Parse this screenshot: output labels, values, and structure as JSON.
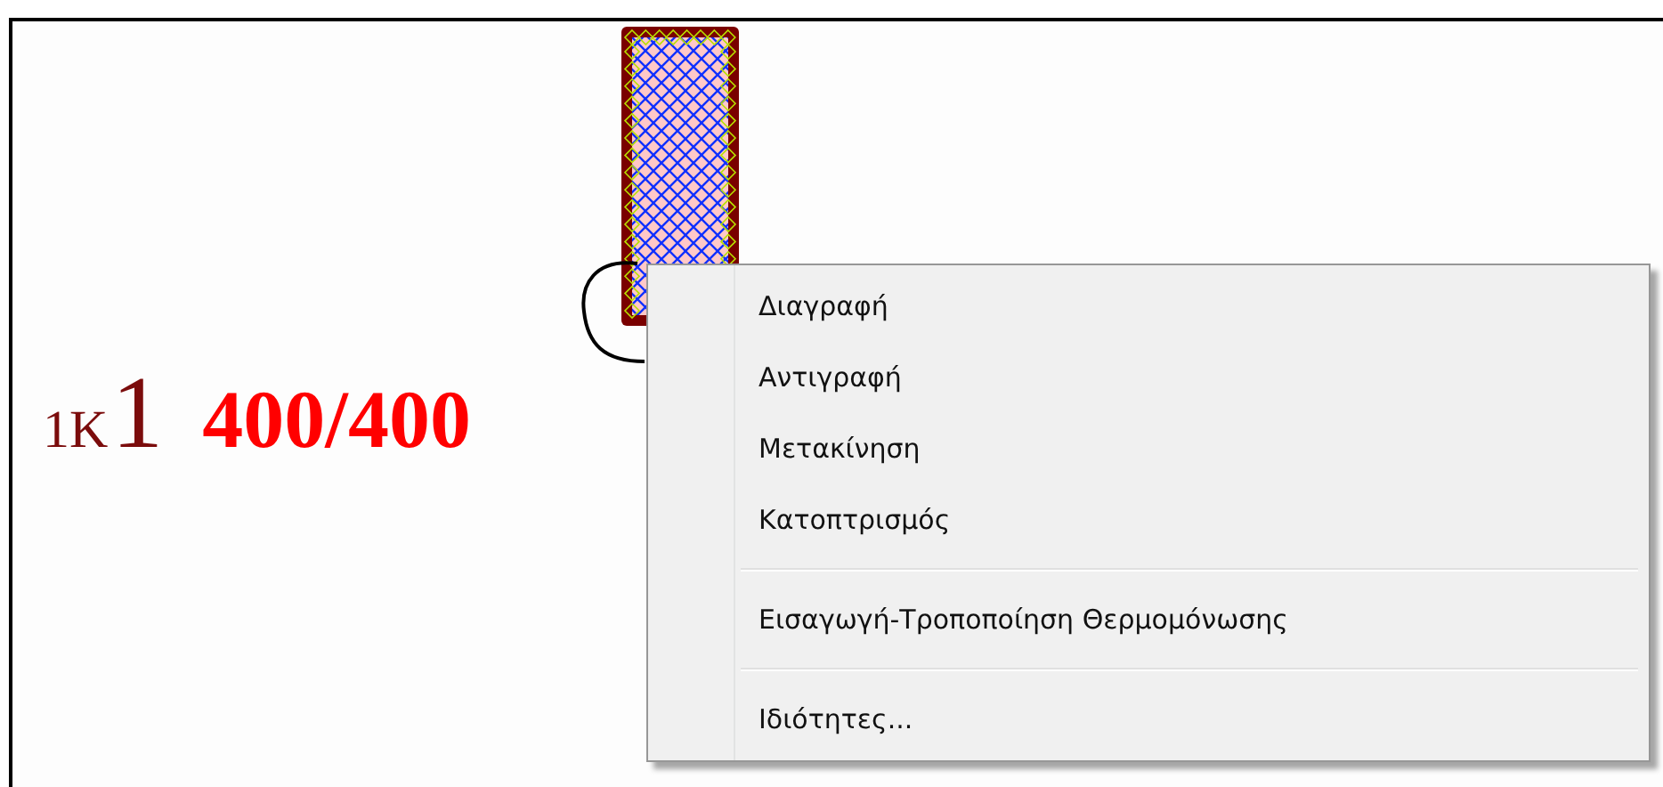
{
  "canvas": {
    "column_label": {
      "prefix": "1K",
      "number": "1",
      "dimensions": "400/400"
    }
  },
  "context_menu": {
    "items": [
      {
        "kind": "item",
        "label": "Διαγραφή"
      },
      {
        "kind": "item",
        "label": "Αντιγραφή"
      },
      {
        "kind": "item",
        "label": "Μετακίνηση"
      },
      {
        "kind": "item",
        "label": "Κατοπτρισμός"
      },
      {
        "kind": "separator"
      },
      {
        "kind": "item",
        "label": "Εισαγωγή-Τροποποίηση Θερμομόνωσης"
      },
      {
        "kind": "separator"
      },
      {
        "kind": "item",
        "label": "Ιδιότητες..."
      }
    ]
  }
}
